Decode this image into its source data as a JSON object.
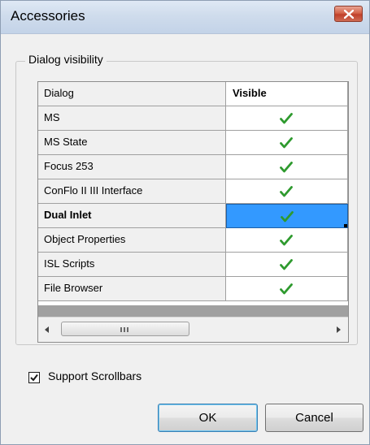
{
  "window": {
    "title": "Accessories",
    "close_icon": "close-x-icon"
  },
  "group": {
    "legend": "Dialog visibility"
  },
  "grid": {
    "columns": {
      "dialog": "Dialog",
      "visible": "Visible"
    },
    "rows": [
      {
        "dialog": "MS",
        "visible": true,
        "selected": false
      },
      {
        "dialog": "MS State",
        "visible": true,
        "selected": false
      },
      {
        "dialog": "Focus 253",
        "visible": true,
        "selected": false
      },
      {
        "dialog": "ConFlo II III Interface",
        "visible": true,
        "selected": false
      },
      {
        "dialog": "Dual Inlet",
        "visible": true,
        "selected": true
      },
      {
        "dialog": "Object Properties",
        "visible": true,
        "selected": false
      },
      {
        "dialog": "ISL Scripts",
        "visible": true,
        "selected": false
      },
      {
        "dialog": "File Browser",
        "visible": true,
        "selected": false
      }
    ],
    "check_color": "#2e9a2e",
    "selected_color": "#3399ff"
  },
  "options": {
    "support_scrollbars_label": "Support Scrollbars",
    "support_scrollbars_checked": true
  },
  "buttons": {
    "ok_label": "OK",
    "cancel_label": "Cancel"
  }
}
